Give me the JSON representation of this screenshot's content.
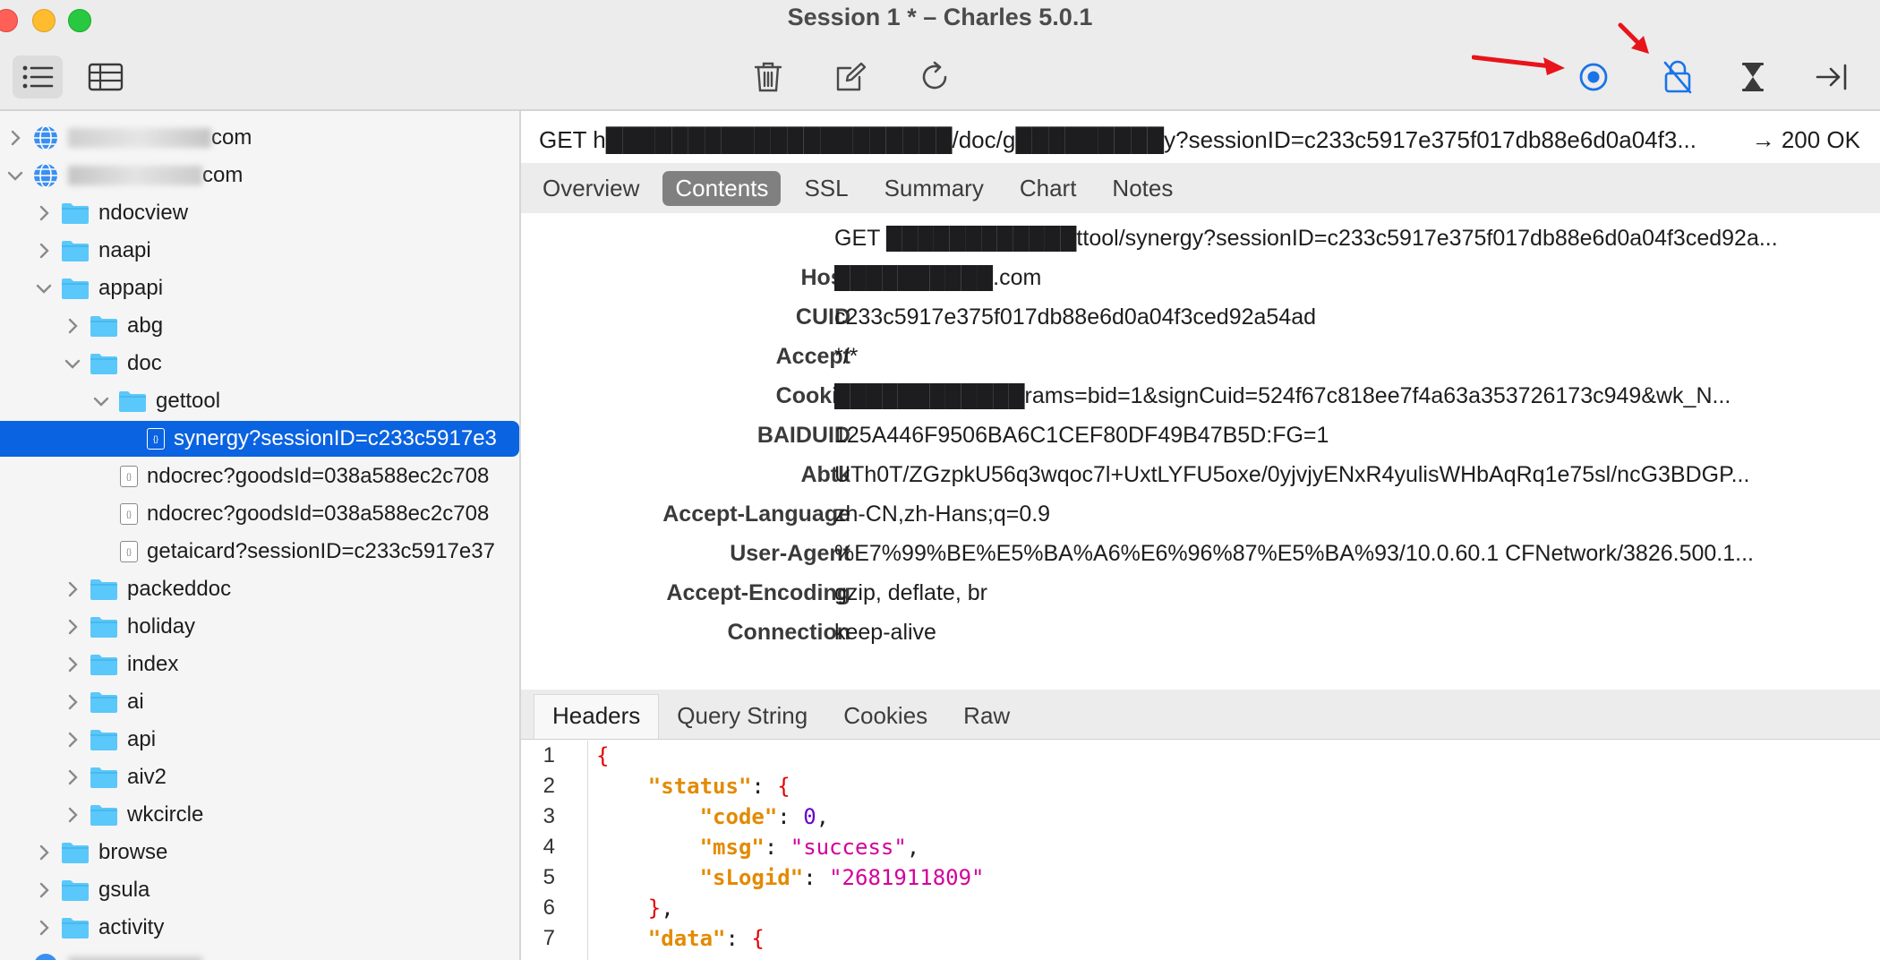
{
  "window": {
    "title": "Session 1 * – Charles 5.0.1"
  },
  "toolbar": {
    "view_icons": [
      "structure-list-icon",
      "sequence-table-icon"
    ],
    "center_icons": [
      "trash-icon",
      "edit-icon",
      "refresh-icon"
    ],
    "right_icons": [
      "record-icon",
      "ssl-proxying-icon",
      "throttle-icon",
      "breakpoint-icon"
    ]
  },
  "sidebar": {
    "hosts": [
      {
        "label": "com",
        "expanded": false
      },
      {
        "label": "com",
        "expanded": true
      }
    ],
    "folders": [
      {
        "label": "ndocview"
      },
      {
        "label": "naapi"
      },
      {
        "label": "appapi"
      },
      {
        "label": "abg"
      },
      {
        "label": "doc"
      },
      {
        "label": "gettool"
      },
      {
        "label": "packeddoc"
      },
      {
        "label": "holiday"
      },
      {
        "label": "index"
      },
      {
        "label": "ai"
      },
      {
        "label": "api"
      },
      {
        "label": "aiv2"
      },
      {
        "label": "wkcircle"
      },
      {
        "label": "browse"
      },
      {
        "label": "gsula"
      },
      {
        "label": "activity"
      }
    ],
    "files": [
      {
        "label": "synergy?sessionID=c233c5917e3",
        "selected": true
      },
      {
        "label": "ndocrec?goodsId=038a588ec2c708",
        "selected": false
      },
      {
        "label": "ndocrec?goodsId=038a588ec2c708",
        "selected": false
      },
      {
        "label": "getaicard?sessionID=c233c5917e37",
        "selected": false
      }
    ]
  },
  "request": {
    "summary": "GET h█████████████████████/doc/g█████████y?sessionID=c233c5917e375f017db88e6d0a04f3...",
    "status": "→ 200 OK"
  },
  "top_tabs": [
    "Overview",
    "Contents",
    "SSL",
    "Summary",
    "Chart",
    "Notes"
  ],
  "headers": [
    {
      "key": "",
      "value": "GET ████████████ttool/synergy?sessionID=c233c5917e375f017db88e6d0a04f3ced92a..."
    },
    {
      "key": "Host",
      "value": "██████████.com"
    },
    {
      "key": "CUID",
      "value": "c233c5917e375f017db88e6d0a04f3ced92a54ad"
    },
    {
      "key": "Accept",
      "value": "*/*"
    },
    {
      "key": "Cookie",
      "value": "████████████rams=bid=1&signCuid=524f67c818ee7f4a63a353726173c949&wk_N..."
    },
    {
      "key": "BAIDUID",
      "value": "125A446F9506BA6C1CEF80DF49B47B5D:FG=1"
    },
    {
      "key": "Abtk",
      "value": "UTh0T/ZGzpkU56q3wqoc7l+UxtLYFU5oxe/0yjvjyENxR4yulisWHbAqRq1e75sl/ncG3BDGP..."
    },
    {
      "key": "Accept-Language",
      "value": "zh-CN,zh-Hans;q=0.9"
    },
    {
      "key": "User-Agent",
      "value": "%E7%99%BE%E5%BA%A6%E6%96%87%E5%BA%93/10.0.60.1 CFNetwork/3826.500.1..."
    },
    {
      "key": "Accept-Encoding",
      "value": "gzip, deflate, br"
    },
    {
      "key": "Connection",
      "value": "keep-alive"
    }
  ],
  "bottom_tabs": [
    "Headers",
    "Query String",
    "Cookies",
    "Raw"
  ],
  "code": {
    "line_numbers": [
      "1",
      "2",
      "3",
      "4",
      "5",
      "6",
      "7"
    ],
    "tokens": {
      "status_key": "\"status\"",
      "code_key": "\"code\"",
      "code_val": "0",
      "msg_key": "\"msg\"",
      "msg_val": "\"success\"",
      "slogid_key": "\"sLogid\"",
      "slogid_val": "\"2681911809\"",
      "data_key": "\"data\""
    }
  },
  "colors": {
    "selection": "#0a63e0",
    "folder": "#5ac8fa",
    "annotation_arrow": "#e8141b",
    "record_active": "#1a73e8"
  }
}
